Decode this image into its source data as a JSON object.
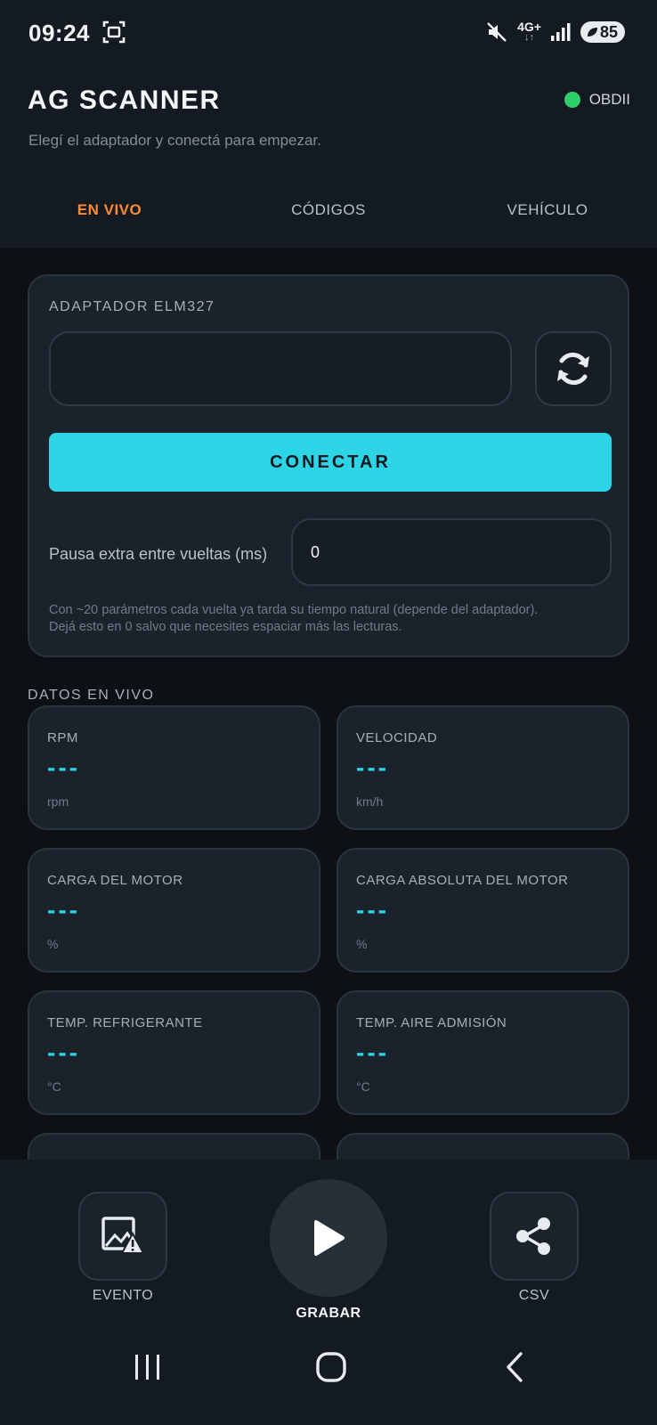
{
  "status_bar": {
    "time": "09:24",
    "network": "4G+",
    "battery": "85",
    "icons": [
      "screenshot-icon",
      "mute-icon",
      "signal-icon",
      "battery-icon"
    ]
  },
  "header": {
    "title": "AG SCANNER",
    "connection_label": "OBDII",
    "connection_color": "#2fcf6b",
    "subtitle": "Elegí el adaptador y conectá para empezar."
  },
  "tabs": [
    {
      "label": "EN VIVO",
      "active": true
    },
    {
      "label": "CÓDIGOS",
      "active": false
    },
    {
      "label": "VEHÍCULO",
      "active": false
    }
  ],
  "adapter_card": {
    "title": "ADAPTADOR ELM327",
    "adapter_value": "",
    "refresh_icon": "refresh-icon",
    "connect_label": "CONECTAR",
    "pause_label": "Pausa extra entre vueltas (ms)",
    "pause_value": "0",
    "help_line1": "Con ~20 parámetros cada vuelta ya tarda su tiempo natural (depende del adaptador).",
    "help_line2": "Dejá esto en 0 salvo que necesites espaciar más las lecturas."
  },
  "live_data": {
    "title": "DATOS EN VIVO",
    "metrics": [
      {
        "name": "RPM",
        "value": "---",
        "unit": "rpm"
      },
      {
        "name": "VELOCIDAD",
        "value": "---",
        "unit": "km/h"
      },
      {
        "name": "CARGA DEL MOTOR",
        "value": "---",
        "unit": "%"
      },
      {
        "name": "CARGA ABSOLUTA DEL MOTOR",
        "value": "---",
        "unit": "%"
      },
      {
        "name": "TEMP. REFRIGERANTE",
        "value": "---",
        "unit": "°C"
      },
      {
        "name": "TEMP. AIRE ADMISIÓN",
        "value": "---",
        "unit": "°C"
      }
    ]
  },
  "bottom_actions": {
    "event_label": "EVENTO",
    "record_label": "GRABAR",
    "csv_label": "CSV"
  },
  "colors": {
    "accent": "#2dd4e6",
    "active_tab": "#ff8a35",
    "background": "#0d1116",
    "card": "#1a222b"
  }
}
